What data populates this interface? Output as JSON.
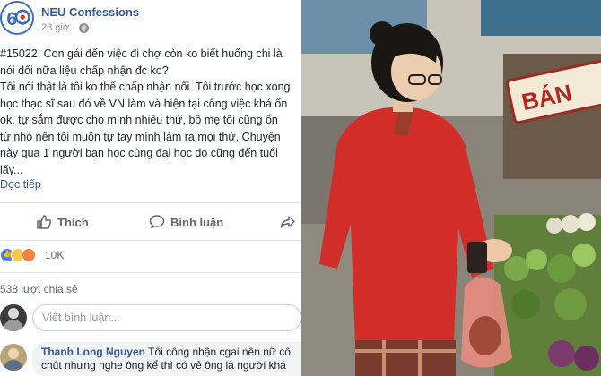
{
  "post": {
    "page_name": "NEU Confessions",
    "avatar_text": "6",
    "time": "23 giờ ·",
    "lines": [
      "#15022: Con gái đến việc đi chợ còn ko biết huống chi là",
      "nói dối nữa liệu chấp nhận đc ko?",
      "Tôi nói thật là tôi ko thể chấp nhận nổi. Tôi trước học xong",
      "học thạc sĩ sau đó về VN làm và hiện tại công việc khá ổn",
      "ok, tự sắm được cho mình nhiều thứ, bố mẹ tôi cũng ổn",
      "từ nhỏ nên tôi muốn tự tay mình làm ra mọi thứ. Chuyện",
      "này qua 1 người bạn học cùng đại học do cũng đến tuổi",
      "lấy..."
    ],
    "see_more": "Đọc tiếp",
    "actions": {
      "like": "Thích",
      "comment": "Bình luận"
    },
    "reaction_count": "10K",
    "shares": "538 lượt chia sẻ",
    "comment_placeholder": "Viết bình luận...",
    "comment": {
      "author": "Thanh Long Nguyen",
      "text_line1": "Tôi công nhận cgai nên nữ cô",
      "text_line2": "chút nhưng nghe ông kể thì có vẻ ông là người khá"
    }
  },
  "photo": {
    "stall_sign": "BÁN"
  },
  "colors": {
    "link_blue": "#365899",
    "muted_gray": "#606770",
    "sweater_red": "#d32d2a"
  }
}
